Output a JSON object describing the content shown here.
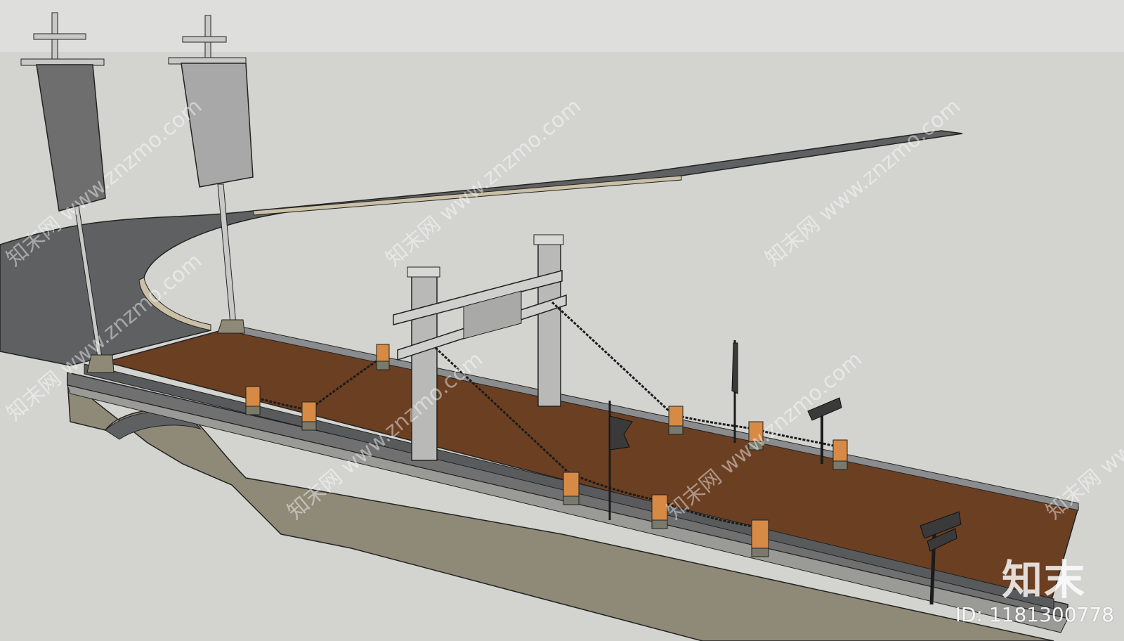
{
  "scene": {
    "description_free": true,
    "colors": {
      "sky": "#dedfdc",
      "ground": "#d3d4cf",
      "road": "#5f6062",
      "road_curb": "#c9c0a6",
      "deck": "#6b3f22",
      "stone": "#b9bab8",
      "abutment": "#8f8a78",
      "post": "#d68a45",
      "chain": "#1b1b1b",
      "banner_dark": "#6e6e6e",
      "banner_light": "#a8a8a8"
    }
  },
  "watermarks": {
    "repeat_text": "知末网 www.znzmo.com",
    "logo": "知末",
    "id_label": "ID: 1181300778"
  }
}
